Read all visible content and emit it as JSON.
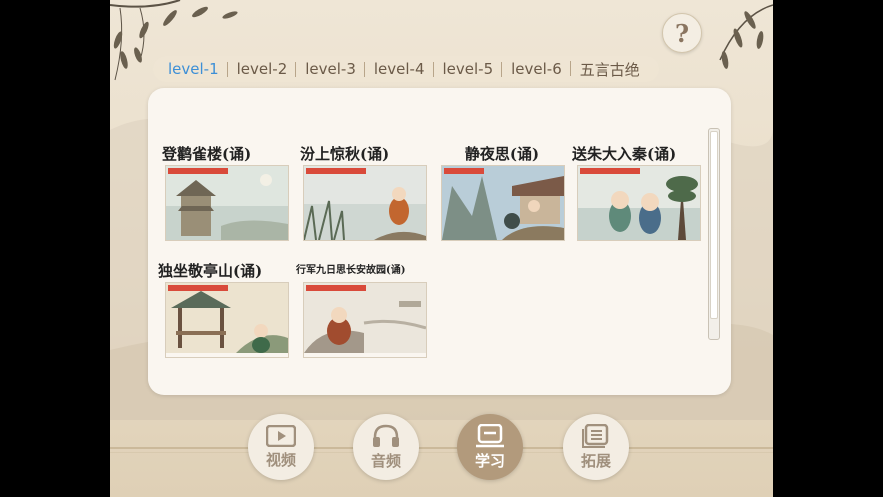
{
  "help": {
    "icon": "?"
  },
  "tabs": [
    {
      "label": "level-1",
      "active": true
    },
    {
      "label": "level-2",
      "active": false
    },
    {
      "label": "level-3",
      "active": false
    },
    {
      "label": "level-4",
      "active": false
    },
    {
      "label": "level-5",
      "active": false
    },
    {
      "label": "level-6",
      "active": false
    },
    {
      "label": "五言古绝",
      "active": false
    }
  ],
  "cards": [
    {
      "title": "登鹳雀楼(诵)"
    },
    {
      "title": "汾上惊秋(诵)"
    },
    {
      "title": "静夜思(诵)"
    },
    {
      "title": "送朱大入秦(诵)"
    },
    {
      "title": "独坐敬亭山(诵)"
    },
    {
      "title": "行军九日思长安故园(诵)"
    }
  ],
  "nav": [
    {
      "label": "视频",
      "icon": "play-icon",
      "active": false
    },
    {
      "label": "音频",
      "icon": "headphones-icon",
      "active": false
    },
    {
      "label": "学习",
      "icon": "book-icon",
      "active": true
    },
    {
      "label": "拓展",
      "icon": "document-icon",
      "active": false
    }
  ],
  "colors": {
    "active_tab": "#3d8fd6",
    "active_nav": "#b29a7c",
    "panel": "#faf6f0"
  }
}
